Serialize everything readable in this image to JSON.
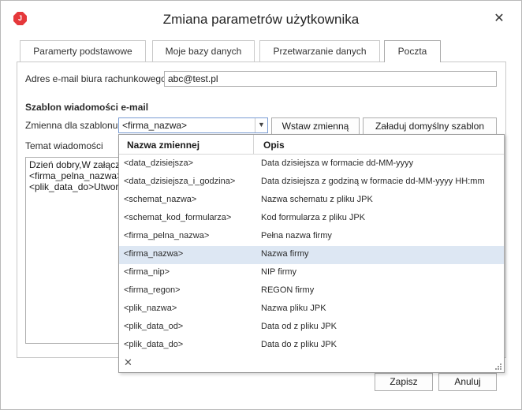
{
  "window": {
    "title": "Zmiana parametrów użytkownika"
  },
  "tabs": [
    {
      "label": "Paramerty podstawowe"
    },
    {
      "label": "Moje bazy danych"
    },
    {
      "label": "Przetwarzanie danych"
    },
    {
      "label": "Poczta"
    }
  ],
  "form": {
    "email_label": "Adres e-mail biura rachunkowego",
    "email_value": "abc@test.pl",
    "section_title": "Szablon wiadomości e-mail",
    "variable_label": "Zmienna dla szablonu",
    "variable_value": "<firma_nazwa>",
    "insert_button": "Wstaw zmienną",
    "load_default_button": "Załaduj domyślny szablon",
    "subject_label": "Temat wiadomości",
    "body_lines": [
      "Dzień dobry,W załączn",
      "<firma_pelna_nazwa>",
      "<plik_data_do>Utworz"
    ]
  },
  "dropdown": {
    "col_name": "Nazwa zmiennej",
    "col_desc": "Opis",
    "close_symbol": "✕",
    "rows": [
      {
        "name": "<data_dzisiejsza>",
        "desc": "Data dzisiejsza w formacie dd-MM-yyyy"
      },
      {
        "name": "<data_dzisiejsza_i_godzina>",
        "desc": "Data dzisiejsza z godziną w formacie dd-MM-yyyy HH:mm"
      },
      {
        "name": "<schemat_nazwa>",
        "desc": "Nazwa schematu z pliku JPK"
      },
      {
        "name": "<schemat_kod_formularza>",
        "desc": "Kod formularza z pliku JPK"
      },
      {
        "name": "<firma_pelna_nazwa>",
        "desc": "Pełna nazwa firmy"
      },
      {
        "name": "<firma_nazwa>",
        "desc": "Nazwa firmy"
      },
      {
        "name": "<firma_nip>",
        "desc": "NIP firmy"
      },
      {
        "name": "<firma_regon>",
        "desc": "REGON firmy"
      },
      {
        "name": "<plik_nazwa>",
        "desc": "Nazwa pliku JPK"
      },
      {
        "name": "<plik_data_od>",
        "desc": "Data od z pliku JPK"
      },
      {
        "name": "<plik_data_do>",
        "desc": "Data do z pliku JPK"
      }
    ],
    "selected_index": 5
  },
  "footer": {
    "save_button": "Zapisz",
    "cancel_button": "Anuluj"
  },
  "colors": {
    "app_icon": "#e5383b",
    "selected_row": "#dde7f3",
    "combo_border": "#7a9cd3"
  }
}
